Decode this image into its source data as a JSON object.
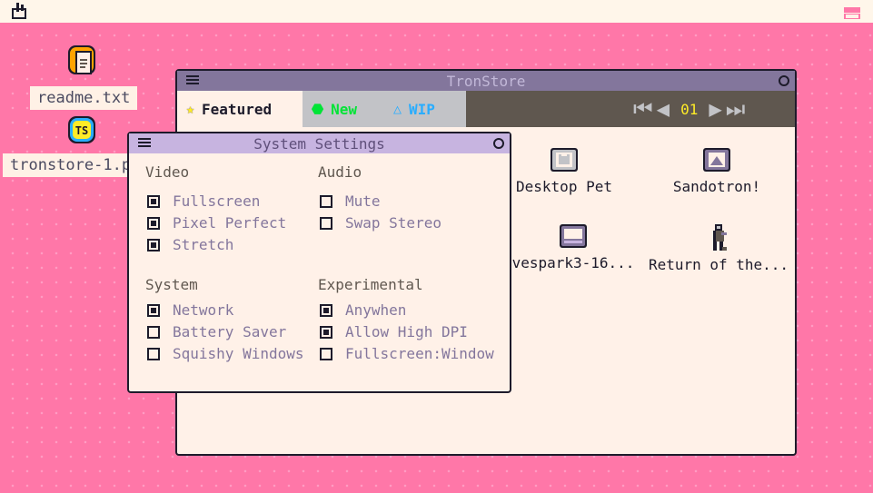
{
  "desktop": {
    "icons": [
      {
        "label": "readme.txt",
        "icon": "text-file-icon"
      },
      {
        "label": "tronstore-1.p",
        "icon": "tronstore-badge-icon",
        "badge": "TS"
      }
    ]
  },
  "tronstore": {
    "title": "TronStore",
    "tabs": [
      {
        "label": "Featured",
        "icon": "star-icon",
        "color": "#ffec27",
        "bg": "#fff1e8"
      },
      {
        "label": "New",
        "icon": "gem-icon",
        "color": "#00e436",
        "bg": "#c2c3c7"
      },
      {
        "label": "WIP",
        "icon": "triangle-icon",
        "color": "#29adff",
        "bg": "#c2c3c7"
      }
    ],
    "page": "01",
    "apps": [
      {
        "label": "Desktop Pet",
        "icon": "cat-monitor-icon"
      },
      {
        "label": "Sandotron!",
        "icon": "landscape-monitor-icon"
      },
      {
        "label": "vespark3-16...",
        "icon": "monitor-icon"
      },
      {
        "label": "Return of the...",
        "icon": "character-sprite-icon"
      }
    ]
  },
  "settings": {
    "title": "System Settings",
    "sections": [
      {
        "heading": "Video",
        "options": [
          {
            "label": "Fullscreen",
            "checked": true
          },
          {
            "label": "Pixel Perfect",
            "checked": true
          },
          {
            "label": "Stretch",
            "checked": true
          }
        ]
      },
      {
        "heading": "Audio",
        "options": [
          {
            "label": "Mute",
            "checked": false
          },
          {
            "label": "Swap Stereo",
            "checked": false
          }
        ]
      },
      {
        "heading": "System",
        "options": [
          {
            "label": "Network",
            "checked": true
          },
          {
            "label": "Battery Saver",
            "checked": false
          },
          {
            "label": "Squishy Windows",
            "checked": false
          }
        ]
      },
      {
        "heading": "Experimental",
        "options": [
          {
            "label": "Anywhen",
            "checked": true
          },
          {
            "label": "Allow High DPI",
            "checked": true
          },
          {
            "label": "Fullscreen:Window",
            "checked": false
          }
        ]
      }
    ]
  },
  "colors": {
    "desktop": "#ff77a8",
    "window": "#fff1e8",
    "tronstore_title": "#83769c",
    "settings_title": "#c7b4e0"
  }
}
